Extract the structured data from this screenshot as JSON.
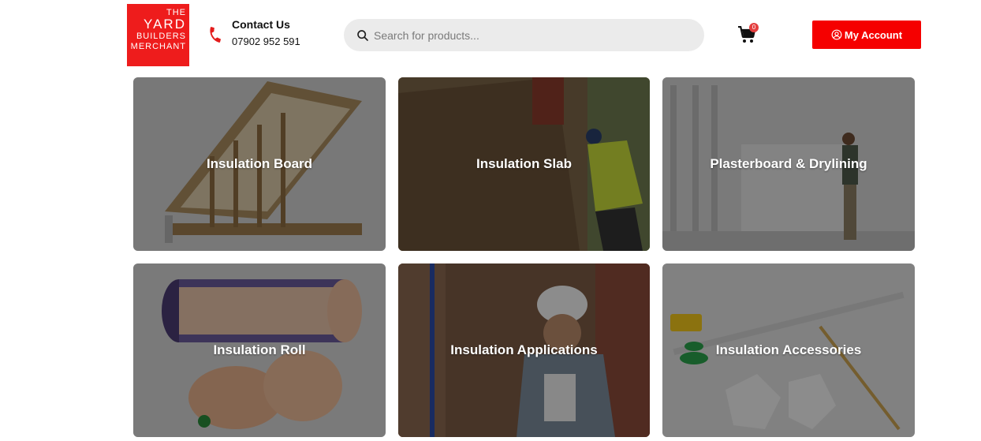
{
  "logo": {
    "line1": "THE",
    "line2": "YARD",
    "line3": "BUILDERS",
    "line4": "MERCHANT"
  },
  "contact": {
    "title": "Contact Us",
    "phone": "07902 952 591"
  },
  "search": {
    "placeholder": "Search for products..."
  },
  "cart": {
    "count": "0"
  },
  "account": {
    "label": "My Account"
  },
  "categories": [
    {
      "label": "Insulation Board"
    },
    {
      "label": "Insulation Slab"
    },
    {
      "label": "Plasterboard & Drylining"
    },
    {
      "label": "Insulation Roll"
    },
    {
      "label": "Insulation Applications"
    },
    {
      "label": "Insulation Accessories"
    }
  ],
  "colors": {
    "brand": "#ee1c1c",
    "button": "#f50000",
    "badge": "#e43f3f"
  }
}
